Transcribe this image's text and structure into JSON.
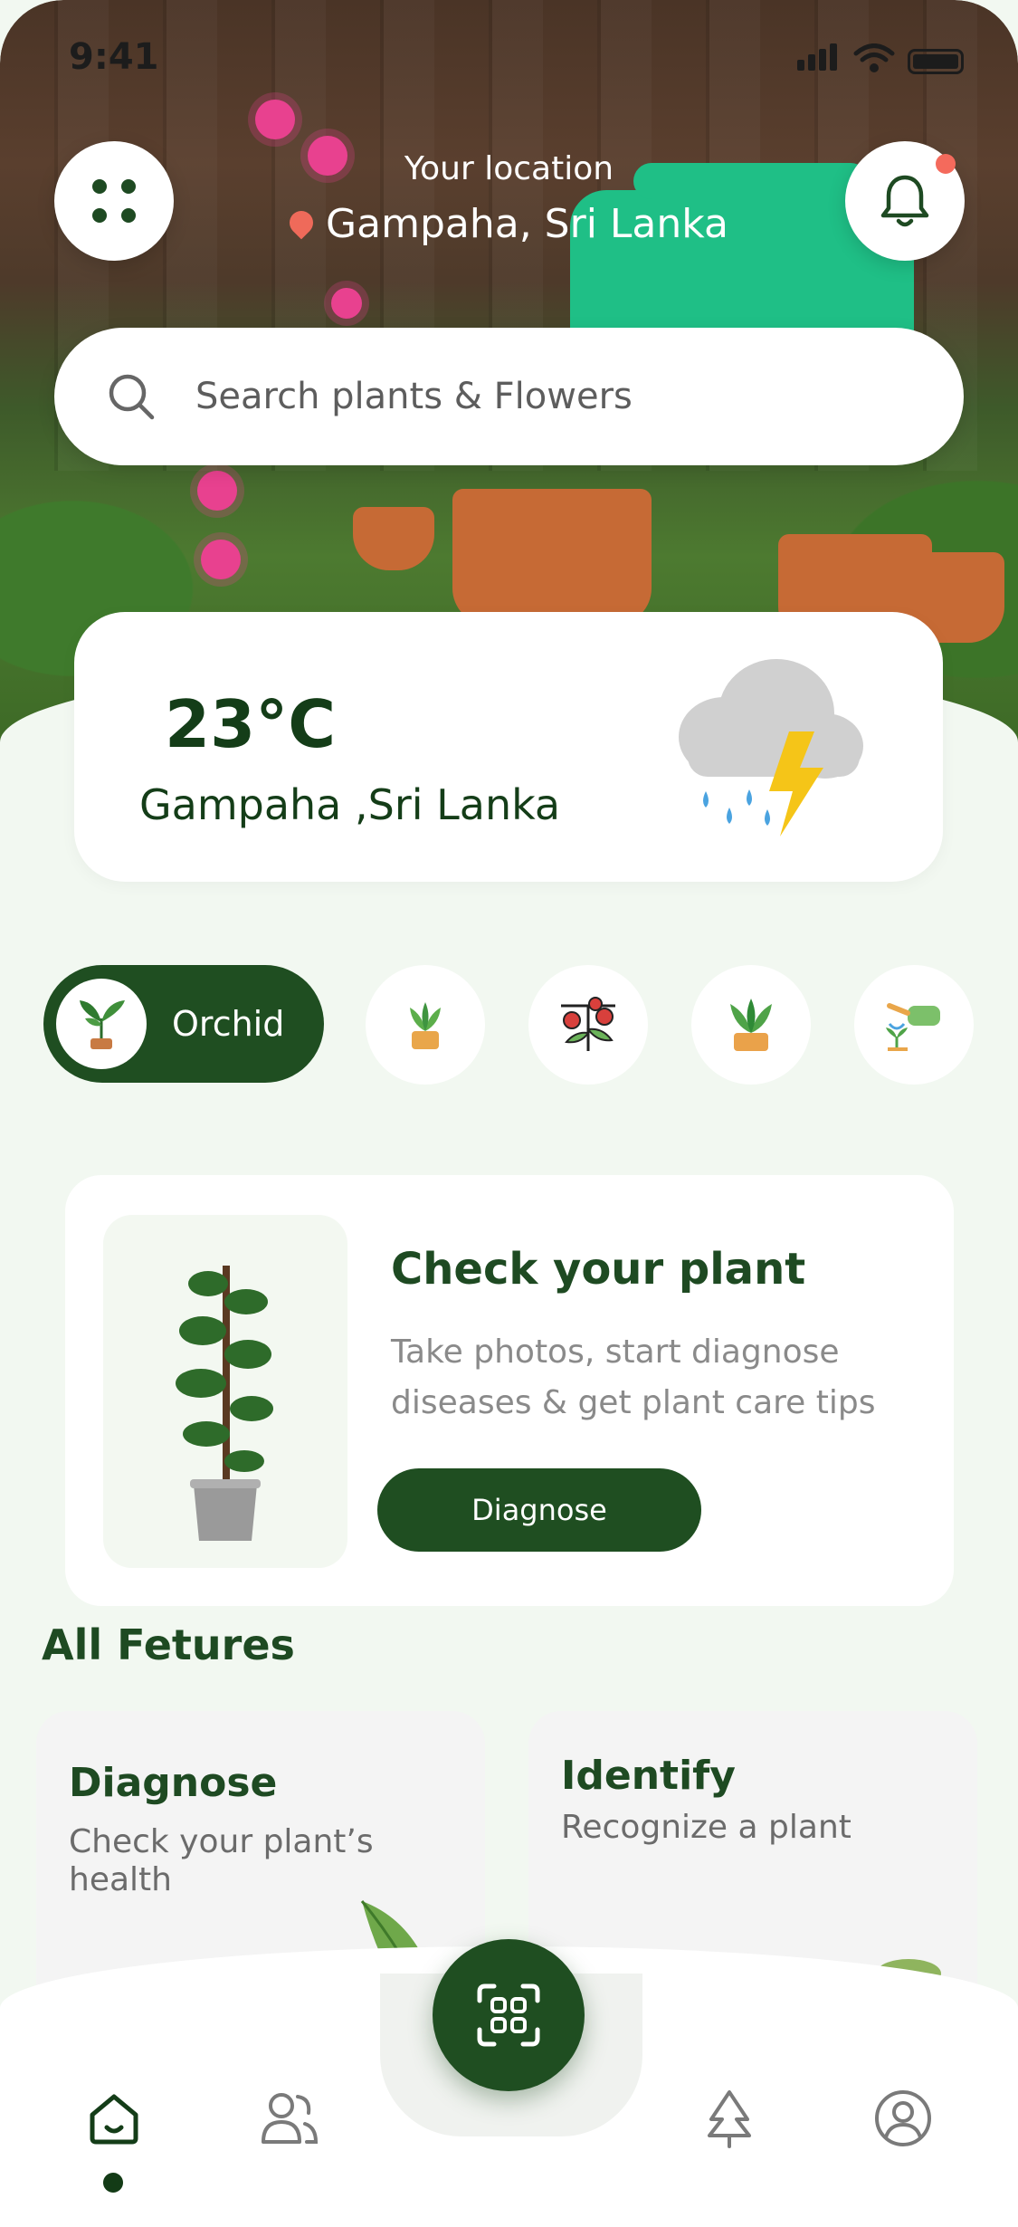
{
  "status": {
    "time": "9:41"
  },
  "header": {
    "location_label": "Your location",
    "location_value": "Gampaha, Sri Lanka",
    "menu_icon": "grid-dots-icon",
    "notification_icon": "bell-icon"
  },
  "search": {
    "placeholder": "Search plants & Flowers"
  },
  "weather": {
    "temperature": "23°C",
    "location": "Gampaha ,Sri Lanka",
    "icon": "thunderstorm-rain-icon"
  },
  "categories": {
    "active": {
      "label": "Orchid",
      "icon": "orchid-plant-icon"
    },
    "items": [
      "succulent-pot-icon",
      "tomato-plant-icon",
      "aloe-pot-icon",
      "watering-can-icon"
    ]
  },
  "check_plant": {
    "title": "Check your plant",
    "description": "Take photos, start diagnose diseases & get plant care tips",
    "button_label": "Diagnose"
  },
  "features": {
    "title": "All Fetures",
    "items": [
      {
        "title": "Diagnose",
        "subtitle": "Check your plant’s health"
      },
      {
        "title": "Identify",
        "subtitle": "Recognize a plant"
      }
    ]
  },
  "nav": {
    "items": [
      "home-icon",
      "community-icon",
      "scan-icon",
      "tree-icon",
      "profile-icon"
    ],
    "active": "home-icon"
  },
  "colors": {
    "primary": "#1f4e21",
    "accent_dot": "#f46a5c",
    "background": "#f2f8f1"
  }
}
